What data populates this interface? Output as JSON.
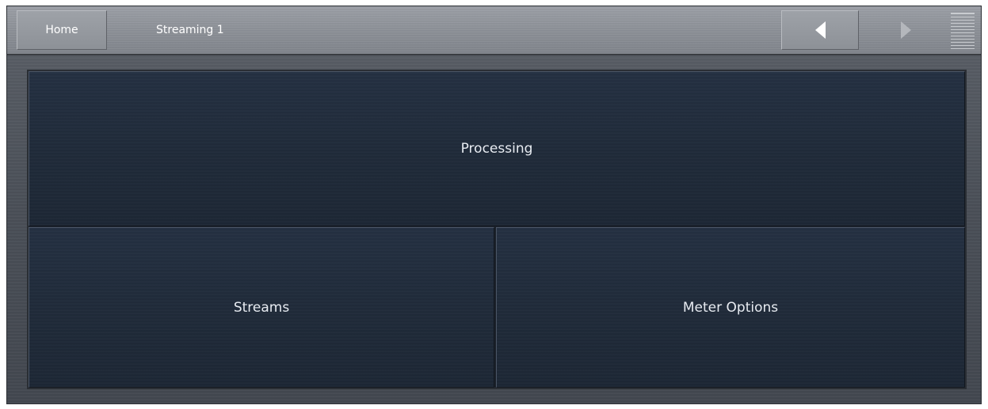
{
  "header": {
    "home_label": "Home",
    "title": "Streaming 1",
    "prev_icon": "triangle-left",
    "next_icon": "triangle-right",
    "menu_icon": "hamburger-lines"
  },
  "tiles": {
    "processing_label": "Processing",
    "streams_label": "Streams",
    "meter_options_label": "Meter Options"
  },
  "colors": {
    "tile_background": "#222d3c",
    "header_background": "#8b8f96",
    "text": "#ffffff"
  }
}
